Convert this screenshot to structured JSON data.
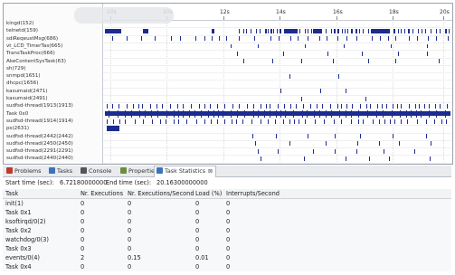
{
  "trace": {
    "tasks": [
      "kingd(152)",
      "telnetd(159)",
      "sdiReqeustMsg(686)",
      "vt_LCD_TimerTas(665)",
      "TransTaskProc(666)",
      "AkeContentSysTask(63)",
      "sh(729)",
      "snmpd(1651)",
      "dhcpc(1656)",
      "kasumaid(2471)",
      "kasumaid(2491)",
      "sudfsd-thread(1913(1913)",
      "Task 0x0",
      "sudfsd-thread(1914(1914)",
      "ps(2631)",
      "sudfsd-thread(2442(2442)",
      "sudfsd-thread(2450(2450)",
      "sudfsd-thread(2291(2291)",
      "sudfsd-thread(2440(2440)"
    ],
    "ruler_ticks": [
      "10s",
      "10s",
      "12s",
      "14s",
      "16s",
      "18s",
      "20s"
    ]
  },
  "tabs": [
    {
      "label": "Problems",
      "icon": "problems-icon",
      "color": "#c0392b"
    },
    {
      "label": "Tasks",
      "icon": "tasks-icon",
      "color": "#3b73b9"
    },
    {
      "label": "Console",
      "icon": "console-icon",
      "color": "#555555"
    },
    {
      "label": "Properties",
      "icon": "properties-icon",
      "color": "#6a8f3a"
    },
    {
      "label": "Task Statistics",
      "icon": "statistics-icon",
      "color": "#3b73b9",
      "close": "⊠"
    }
  ],
  "time_range": {
    "start_label": "Start time (sec):",
    "start_value": "6.72180000000",
    "end_label": "End time (sec):",
    "end_value": "20.16300000000"
  },
  "table": {
    "columns": [
      "Task",
      "Nr. Executions",
      "Nr. Executions/Second",
      "Load (%)",
      "Interrupts/Second"
    ],
    "rows": [
      [
        "init(1)",
        "0",
        "0",
        "0",
        "0"
      ],
      [
        "Task 0x1",
        "0",
        "0",
        "0",
        "0"
      ],
      [
        "ksoftirqd/0(2)",
        "0",
        "0",
        "0",
        "0"
      ],
      [
        "Task 0x2",
        "0",
        "0",
        "0",
        "0"
      ],
      [
        "watchdog/0(3)",
        "0",
        "0",
        "0",
        "0"
      ],
      [
        "Task 0x3",
        "0",
        "0",
        "0",
        "0"
      ],
      [
        "events/0(4)",
        "2",
        "0.15",
        "0.01",
        "0"
      ],
      [
        "Task 0x4",
        "0",
        "0",
        "0",
        "0"
      ]
    ]
  },
  "colors": {
    "event_bar": "#1c2b8f"
  }
}
